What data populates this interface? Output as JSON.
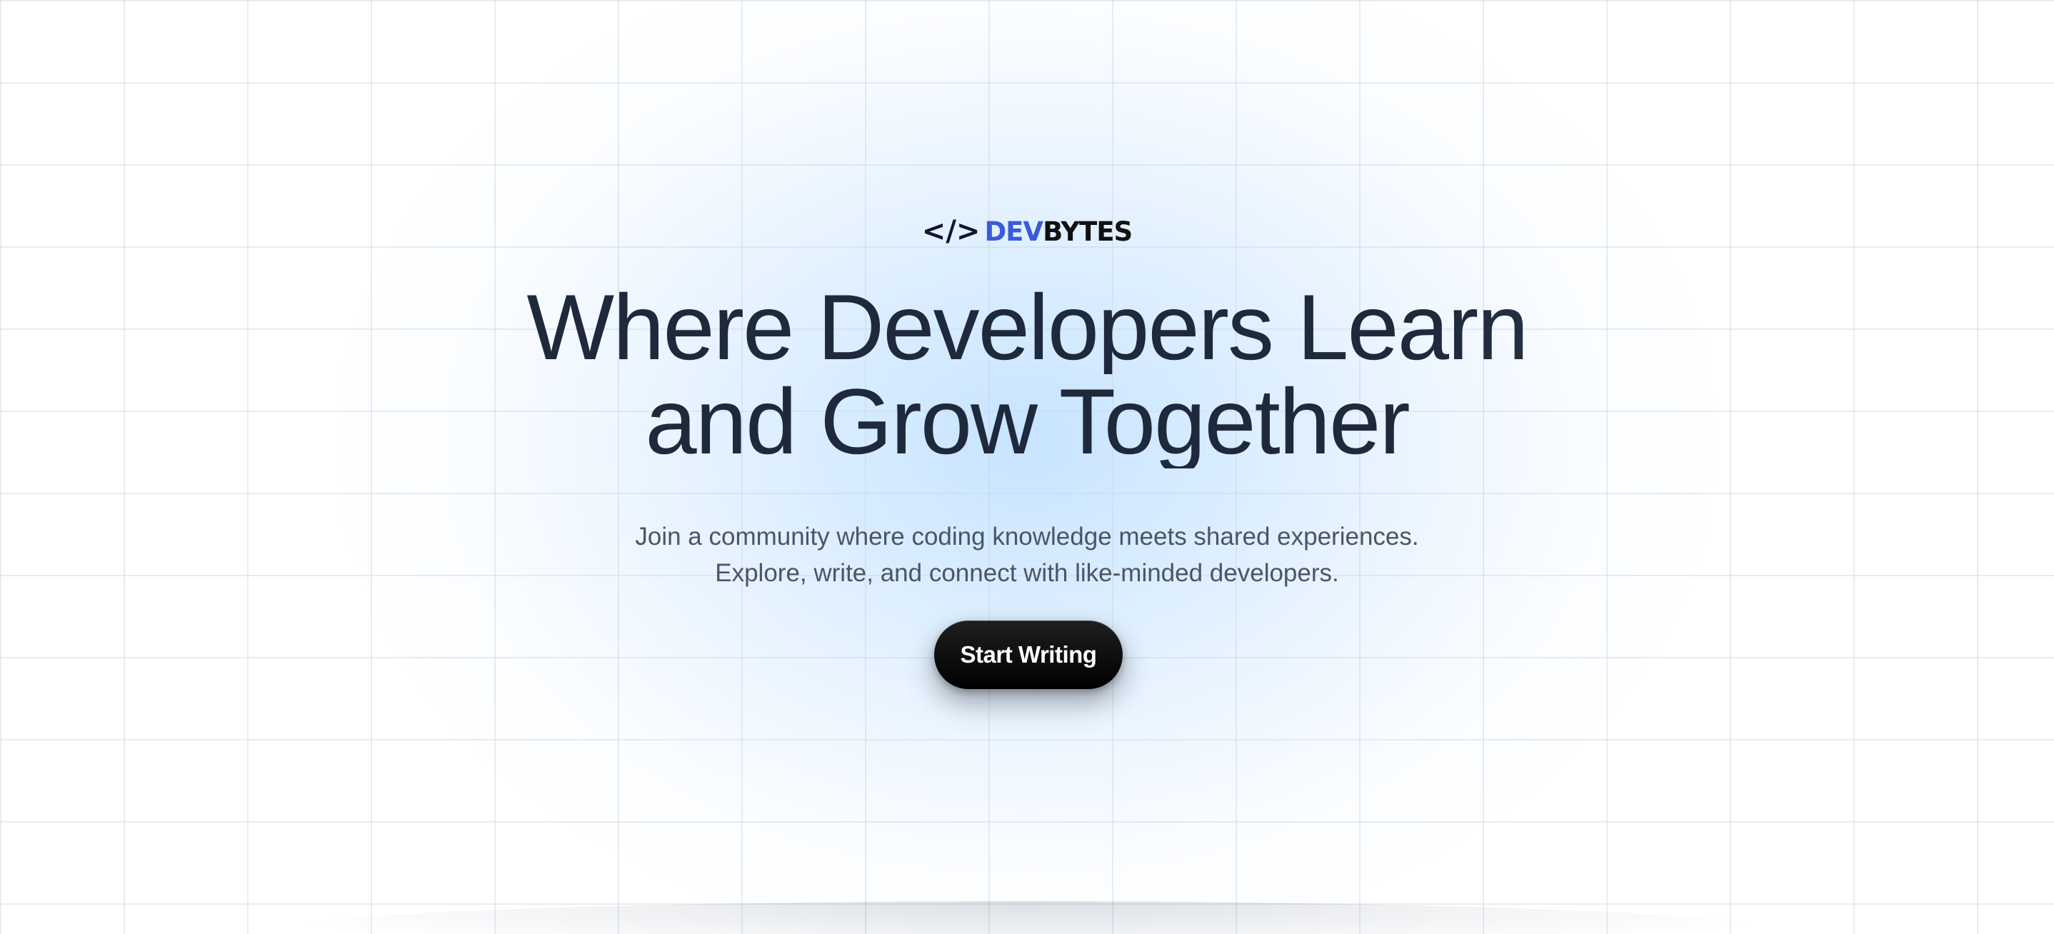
{
  "brand": {
    "icon": "code-brackets-icon",
    "icon_glyph": "</>",
    "name_part1": "DEV",
    "name_part2": "BYTES",
    "accent_color": "#3b5bdb",
    "text_color": "#111111"
  },
  "hero": {
    "headline_line1": "Where Developers Learn",
    "headline_line2": "and Grow Together",
    "subtitle_line1": "Join a community where coding knowledge meets shared experiences.",
    "subtitle_line2": "Explore, write, and connect with like-minded developers.",
    "cta_label": "Start Writing"
  },
  "colors": {
    "background": "#ffffff",
    "glow": "#c4e2ff",
    "grid_line": "#cbd5e1",
    "headline": "#1e293b",
    "subtitle": "#4b5563",
    "button": "#000000",
    "button_text": "#ffffff"
  }
}
